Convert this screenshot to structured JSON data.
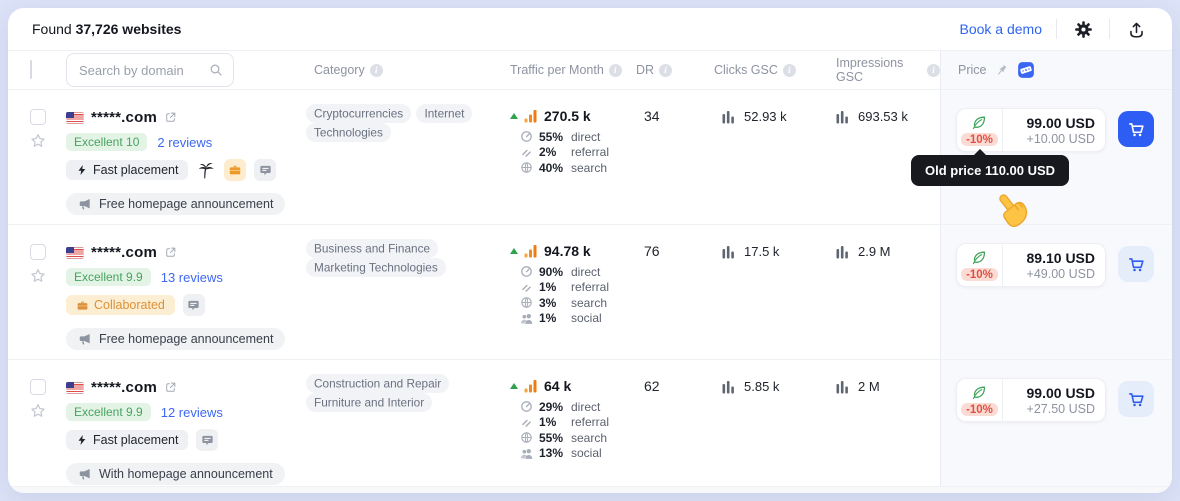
{
  "toolbar": {
    "found_label": "Found",
    "found_strong": "37,726 websites",
    "book_demo": "Book a demo"
  },
  "table_header": {
    "search_placeholder": "Search by domain",
    "category": "Category",
    "traffic": "Traffic per Month",
    "dr": "DR",
    "clicks": "Clicks GSC",
    "impressions": "Impressions GSC",
    "price": "Price"
  },
  "tooltip": {
    "text": "Old price 110.00 USD"
  },
  "icons": {
    "search": "magnifier-icon",
    "info": "circle-i-icon",
    "settings": "gear-icon",
    "export": "upload-arrow-icon",
    "favorite": "star-outline-icon",
    "flag": "us-flag-icon",
    "external": "external-link-icon",
    "fast_placement": "lightning-icon",
    "niche": "palm-tree-icon",
    "collaborated": "briefcase-icon",
    "comments": "speech-bubble-icon",
    "announcement": "megaphone-icon",
    "eco_discount": "leaf-icon",
    "cart": "shopping-cart-icon",
    "pin": "pushpin-icon",
    "promo": "coupon-icon",
    "traffic_bars": "bar-chart-orange-icon",
    "gsc_bars": "bar-chart-gray-icon",
    "trend": "triangle-up-icon",
    "direct": "gauge-icon",
    "referral": "link-icon",
    "search_source": "globe-icon",
    "social": "people-icon",
    "pointer": "pointing-hand-emoji"
  },
  "colors": {
    "accent_blue": "#2e5df3",
    "link_blue": "#3d68f2",
    "success_green": "#49a25e",
    "discount_red": "#e04f44",
    "traffic_orange": "#ee7c12",
    "page_bg": "#dce2f7",
    "price_col_bg": "#f8f9fd",
    "tooltip_bg": "#17191f"
  },
  "rows": [
    {
      "domain": "*****.com",
      "rating": "Excellent 10",
      "reviews": "2 reviews",
      "fast_badge": "Fast placement",
      "announcement": "Free homepage announcement",
      "categories": [
        "Cryptocurrencies",
        "Internet Technologies"
      ],
      "traffic": "270.5 k",
      "dr": "34",
      "breakdown": [
        {
          "pct": "55%",
          "label": "direct"
        },
        {
          "pct": "2%",
          "label": "referral"
        },
        {
          "pct": "40%",
          "label": "search"
        }
      ],
      "clicks": "52.93 k",
      "impressions": "693.53 k",
      "discount": "-10%",
      "price": "99.00 USD",
      "extra": "+10.00 USD"
    },
    {
      "domain": "*****.com",
      "rating": "Excellent 9.9",
      "reviews": "13 reviews",
      "collab_badge": "Collaborated",
      "announcement": "Free homepage announcement",
      "categories": [
        "Business and Finance",
        "Marketing Technologies"
      ],
      "traffic": "94.78 k",
      "dr": "76",
      "breakdown": [
        {
          "pct": "90%",
          "label": "direct"
        },
        {
          "pct": "1%",
          "label": "referral"
        },
        {
          "pct": "3%",
          "label": "search"
        },
        {
          "pct": "1%",
          "label": "social"
        }
      ],
      "clicks": "17.5 k",
      "impressions": "2.9 M",
      "discount": "-10%",
      "price": "89.10 USD",
      "extra": "+49.00 USD"
    },
    {
      "domain": "*****.com",
      "rating": "Excellent 9.9",
      "reviews": "12 reviews",
      "fast_badge": "Fast placement",
      "announcement": "With homepage announcement",
      "categories": [
        "Construction and Repair",
        "Furniture and Interior"
      ],
      "traffic": "64 k",
      "dr": "62",
      "breakdown": [
        {
          "pct": "29%",
          "label": "direct"
        },
        {
          "pct": "1%",
          "label": "referral"
        },
        {
          "pct": "55%",
          "label": "search"
        },
        {
          "pct": "13%",
          "label": "social"
        }
      ],
      "clicks": "5.85 k",
      "impressions": "2 M",
      "discount": "-10%",
      "price": "99.00 USD",
      "extra": "+27.50 USD"
    }
  ]
}
